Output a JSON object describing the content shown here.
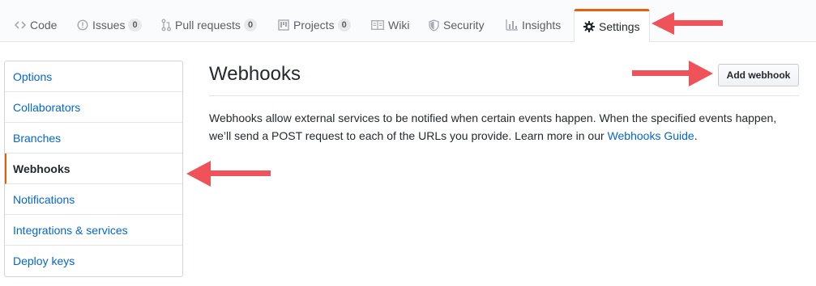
{
  "tabs": [
    {
      "label": "Code",
      "icon": "code-icon"
    },
    {
      "label": "Issues",
      "icon": "issue-opened-icon",
      "count": "0"
    },
    {
      "label": "Pull requests",
      "icon": "git-pull-request-icon",
      "count": "0"
    },
    {
      "label": "Projects",
      "icon": "project-icon",
      "count": "0"
    },
    {
      "label": "Wiki",
      "icon": "book-icon"
    },
    {
      "label": "Security",
      "icon": "shield-icon"
    },
    {
      "label": "Insights",
      "icon": "graph-icon"
    },
    {
      "label": "Settings",
      "icon": "gear-icon",
      "selected": true
    }
  ],
  "sidebar": {
    "items": [
      {
        "label": "Options"
      },
      {
        "label": "Collaborators"
      },
      {
        "label": "Branches"
      },
      {
        "label": "Webhooks",
        "selected": true
      },
      {
        "label": "Notifications"
      },
      {
        "label": "Integrations & services"
      },
      {
        "label": "Deploy keys"
      }
    ]
  },
  "main": {
    "title": "Webhooks",
    "add_button": "Add webhook",
    "description_text": "Webhooks allow external services to be notified when certain events happen. When the specified events happen, we’ll send a POST request to each of the URLs you provide. Learn more in our ",
    "guide_link": "Webhooks Guide",
    "description_end": "."
  },
  "colors": {
    "accent": "#e36209",
    "link": "#0366d6",
    "arrow": "#f0525a"
  }
}
